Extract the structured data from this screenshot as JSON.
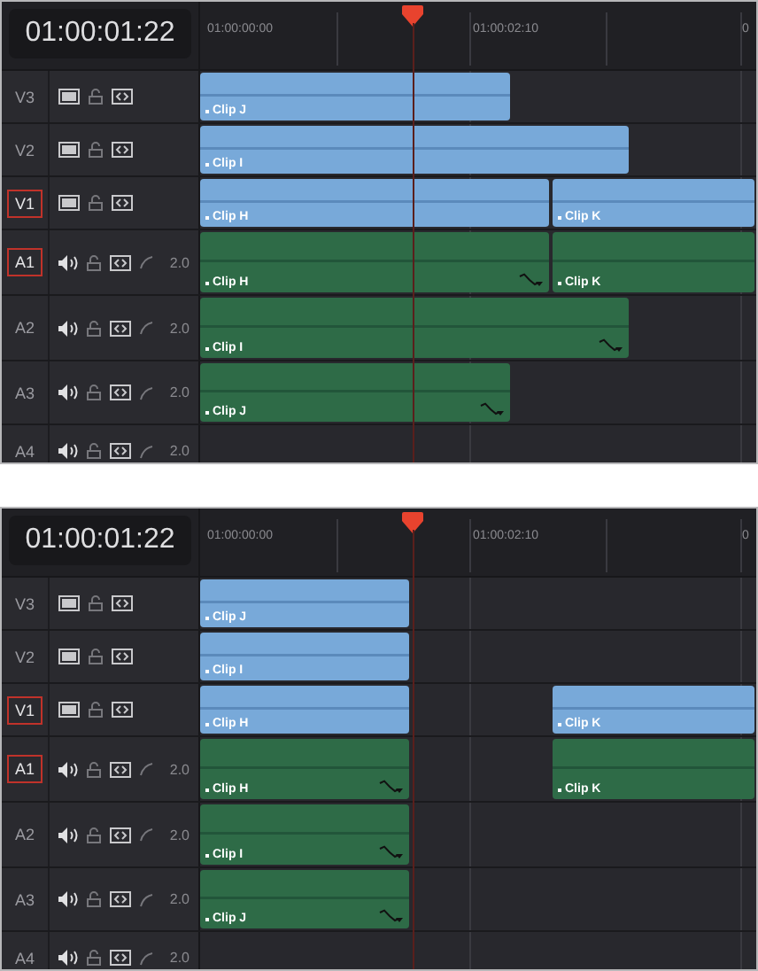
{
  "panels": [
    {
      "timecode": "01:00:01:22",
      "ruler": [
        "01:00:00:00",
        "01:00:02:10",
        "0"
      ],
      "tracks": [
        {
          "label": "V3",
          "kind": "video",
          "targeted": false,
          "clips": [
            {
              "name": "Clip J",
              "curve_icon": false
            }
          ]
        },
        {
          "label": "V2",
          "kind": "video",
          "targeted": false,
          "clips": [
            {
              "name": "Clip I",
              "curve_icon": false
            }
          ]
        },
        {
          "label": "V1",
          "kind": "video",
          "targeted": true,
          "clips": [
            {
              "name": "Clip H",
              "curve_icon": false
            },
            {
              "name": "Clip K",
              "curve_icon": false
            }
          ]
        },
        {
          "label": "A1",
          "kind": "audio",
          "targeted": true,
          "channels": "2.0",
          "clips": [
            {
              "name": "Clip H",
              "curve_icon": true
            },
            {
              "name": "Clip K",
              "curve_icon": false
            }
          ]
        },
        {
          "label": "A2",
          "kind": "audio",
          "targeted": false,
          "channels": "2.0",
          "clips": [
            {
              "name": "Clip I",
              "curve_icon": true
            }
          ]
        },
        {
          "label": "A3",
          "kind": "audio",
          "targeted": false,
          "channels": "2.0",
          "clips": [
            {
              "name": "Clip J",
              "curve_icon": true
            }
          ]
        },
        {
          "label": "A4",
          "kind": "audio",
          "targeted": false,
          "channels": "2.0"
        }
      ]
    },
    {
      "timecode": "01:00:01:22",
      "ruler": [
        "01:00:00:00",
        "01:00:02:10",
        "0"
      ],
      "tracks": [
        {
          "label": "V3",
          "kind": "video",
          "targeted": false,
          "clips": [
            {
              "name": "Clip J",
              "curve_icon": false
            }
          ]
        },
        {
          "label": "V2",
          "kind": "video",
          "targeted": false,
          "clips": [
            {
              "name": "Clip I",
              "curve_icon": false
            }
          ]
        },
        {
          "label": "V1",
          "kind": "video",
          "targeted": true,
          "clips": [
            {
              "name": "Clip H",
              "curve_icon": false
            },
            {
              "name": "Clip K",
              "curve_icon": false
            }
          ]
        },
        {
          "label": "A1",
          "kind": "audio",
          "targeted": true,
          "channels": "2.0",
          "clips": [
            {
              "name": "Clip H",
              "curve_icon": true
            },
            {
              "name": "Clip K",
              "curve_icon": false
            }
          ]
        },
        {
          "label": "A2",
          "kind": "audio",
          "targeted": false,
          "channels": "2.0",
          "clips": [
            {
              "name": "Clip I",
              "curve_icon": true
            }
          ]
        },
        {
          "label": "A3",
          "kind": "audio",
          "targeted": false,
          "channels": "2.0",
          "clips": [
            {
              "name": "Clip J",
              "curve_icon": true
            }
          ]
        },
        {
          "label": "A4",
          "kind": "audio",
          "targeted": false,
          "channels": "2.0"
        }
      ]
    }
  ]
}
